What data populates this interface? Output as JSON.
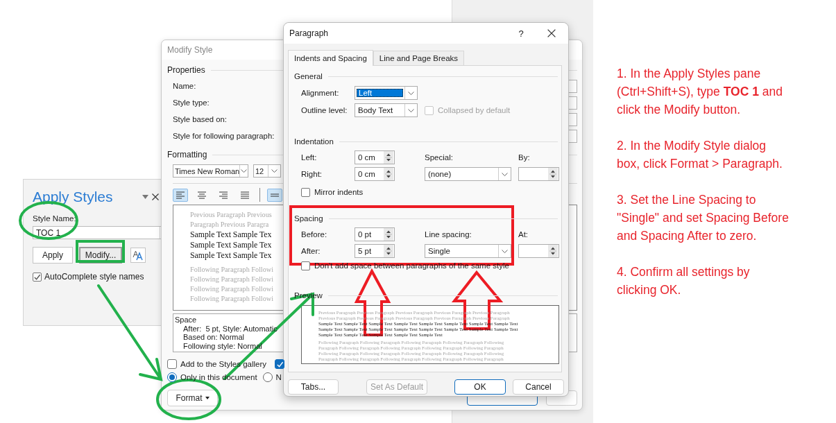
{
  "apply_styles": {
    "title": "Apply Styles",
    "style_name_label": "Style Name:",
    "style_name": "TOC 1",
    "buttons": [
      "Apply",
      "Modify..."
    ],
    "autocomplete": {
      "label": "AutoComplete style names",
      "checked": true
    }
  },
  "modify_style": {
    "title": "Modify Style",
    "properties_heading": "Properties",
    "property_labels": [
      "Name:",
      "Style type:",
      "Style based on:",
      "Style for following paragraph:"
    ],
    "formatting_heading": "Formatting",
    "font": "Times New Roman",
    "size": "12",
    "alignment_buttons": [
      {
        "kind": "left",
        "selected": true
      },
      {
        "kind": "center",
        "selected": false
      },
      {
        "kind": "right",
        "selected": false
      },
      {
        "kind": "justify",
        "selected": false
      },
      {
        "kind": "spacing",
        "selected": true
      }
    ],
    "preview": {
      "previous": [
        "Previous Paragraph Previous",
        "Paragraph Previous Paragra"
      ],
      "sample": [
        "Sample Text Sample Tex",
        "Sample Text Sample Tex",
        "Sample Text Sample Tex"
      ],
      "following": [
        "Following Paragraph Followi",
        "Following Paragraph Followi",
        "Following Paragraph Followi",
        "Following Paragraph Followi"
      ]
    },
    "description": [
      "Space",
      "After:  5 pt, Style: Automatic",
      "Based on: Normal",
      "Following style: Normal"
    ],
    "gallery": {
      "label": "Add to the Styles gallery",
      "checked": false
    },
    "second_option": {
      "checked": true
    },
    "radios": [
      {
        "label": "Only in this document",
        "selected": true
      },
      {
        "label": "N",
        "selected": false
      }
    ],
    "format_button": "Format"
  },
  "paragraph": {
    "title": "Paragraph",
    "help": "?",
    "tabs": [
      {
        "label": "Indents and Spacing",
        "selected": true
      },
      {
        "label": "Line and Page Breaks",
        "selected": false
      }
    ],
    "general": {
      "heading": "General",
      "alignment": {
        "label": "Alignment:",
        "value": "Left"
      },
      "outline_level": {
        "label": "Outline level:",
        "value": "Body Text"
      },
      "collapsed": {
        "label": "Collapsed by default",
        "checked": false,
        "disabled": true
      }
    },
    "indentation": {
      "heading": "Indentation",
      "left": {
        "label": "Left:",
        "value": "0 cm"
      },
      "right": {
        "label": "Right:",
        "value": "0 cm"
      },
      "special": {
        "label": "Special:",
        "value": "(none)"
      },
      "by": {
        "label": "By:"
      },
      "mirror": {
        "label": "Mirror indents",
        "checked": false
      }
    },
    "spacing": {
      "heading": "Spacing",
      "before": {
        "label": "Before:",
        "value": "0 pt"
      },
      "after": {
        "label": "After:",
        "value": "5 pt"
      },
      "line_spacing": {
        "label": "Line spacing:",
        "value": "Single"
      },
      "at": {
        "label": "At:"
      },
      "dont_add": {
        "label": "Don't add space between paragraphs of the same style",
        "checked": false
      }
    },
    "preview": {
      "heading": "Preview",
      "previous": [
        "Previous Paragraph Previous Paragraph Previous Paragraph Previous Paragraph Previous Paragraph",
        "Previous Paragraph Previous Paragraph Previous Paragraph Previous Paragraph Previous Paragraph"
      ],
      "sample": [
        "Sample Text Sample Text Sample Text Sample Text Sample Text Sample Text Sample Text Sample Text",
        "Sample Text Sample Text Sample Text Sample Text Sample Text Sample Text Sample Text Sample Text",
        "Sample Text Sample Text Sample Text Sample Text Sample Text"
      ],
      "following": [
        "Following Paragraph Following Paragraph Following Paragraph Following Paragraph Following",
        "Paragraph Following Paragraph Following Paragraph Following Paragraph Following Paragraph",
        "Following Paragraph Following Paragraph Following Paragraph Following Paragraph Following",
        "Paragraph Following Paragraph Following Paragraph Following Paragraph Following Paragraph"
      ]
    },
    "buttons": [
      {
        "label": "Tabs...",
        "kind": "normal"
      },
      {
        "label": "Set As Default",
        "kind": "disabled"
      },
      {
        "label": "OK",
        "kind": "default"
      },
      {
        "label": "Cancel",
        "kind": "normal"
      }
    ]
  },
  "instructions": [
    "1. In the Apply Styles pane (Ctrl+Shift+S), type **TOC 1** and click the Modify button.",
    "2. In the Modify Style dialog box, click Format > Paragraph.",
    "3. Set the Line Spacing to \"Single\" and set Spacing Before and Spacing After to zero.",
    "4. Confirm all settings by clicking OK."
  ]
}
